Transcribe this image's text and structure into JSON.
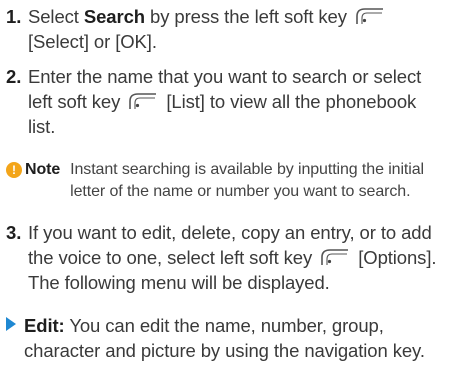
{
  "step1": {
    "number": "1.",
    "text_a": "Select ",
    "bold_a": "Search",
    "text_b": " by press the left soft key",
    "line2": "[Select] or [OK]."
  },
  "step2": {
    "number": "2.",
    "line1": "Enter the name that you want to search or select",
    "line2_a": "left soft key",
    "line2_b": "[List] to view all the phonebook",
    "line3": "list."
  },
  "note": {
    "icon": "!",
    "label": "Note",
    "line1": "Instant searching is available by inputting the initial",
    "line2": "letter of the name or number you want to search."
  },
  "step3": {
    "number": "3.",
    "line1": "If you want to edit, delete, copy an entry, or to add",
    "line2_a": "the voice to one, select left soft key",
    "line2_b": "[Options].",
    "line3": "The following menu will be displayed."
  },
  "bullet_edit": {
    "label": "Edit:",
    "line1": " You can edit the name, number, group,",
    "line2": "character and picture by using the navigation key."
  },
  "icons": {
    "softkey": "left-soft-key-icon",
    "note": "note-icon",
    "bullet": "triangle-bullet-icon"
  },
  "colors": {
    "note_icon": "#f3a51a",
    "bullet": "#1f88d2"
  }
}
